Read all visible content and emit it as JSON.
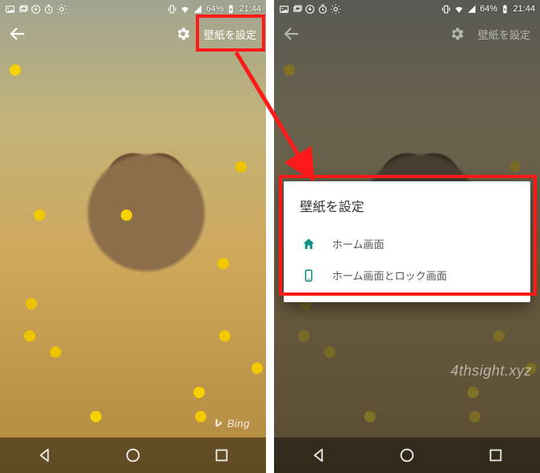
{
  "status": {
    "battery_text": "64%",
    "time_text": "21:44"
  },
  "appbar": {
    "set_wallpaper_label": "壁紙を設定"
  },
  "dialog": {
    "title": "壁紙を設定",
    "option_home_label": "ホーム画面",
    "option_home_lock_label": "ホーム画面とロック画面"
  },
  "attribution": {
    "brand": "Bing"
  },
  "watermark": "4thsight.xyz",
  "colors": {
    "highlight": "#ff1a1a",
    "dialog_icon": "#0e8f80"
  }
}
